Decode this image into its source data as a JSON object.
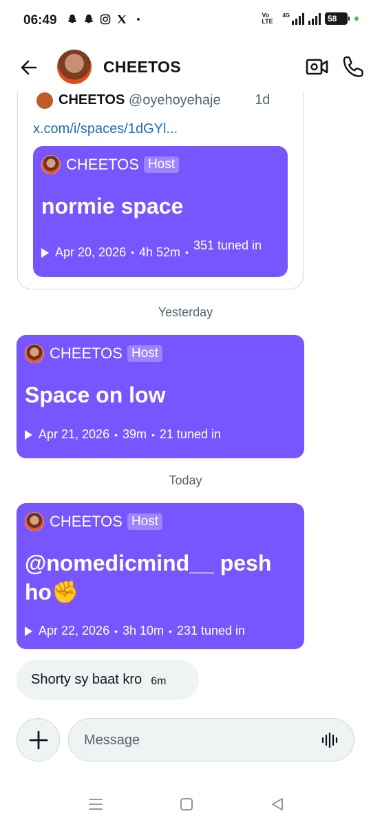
{
  "status_bar": {
    "time": "06:49",
    "left_icons": [
      "snapchat-icon",
      "snapchat-icon",
      "instagram-icon",
      "x-icon",
      "dot"
    ],
    "volte": "Vo LTE",
    "network": "4G",
    "battery": "58"
  },
  "header": {
    "title": "CHEETOS"
  },
  "shared_post": {
    "author": "CHEETOS",
    "handle": "@oyehoyehaje",
    "age": "1d",
    "link": "x.com/i/spaces/1dGYl..."
  },
  "spaces": [
    {
      "host": "CHEETOS",
      "badge": "Host",
      "title": "normie space",
      "date": "Apr 20, 2026",
      "duration": "4h 52m",
      "listeners": "351 tuned in"
    },
    {
      "host": "CHEETOS",
      "badge": "Host",
      "title": "Space on low",
      "date": "Apr 21, 2026",
      "duration": "39m",
      "listeners": "21 tuned in"
    },
    {
      "host": "CHEETOS",
      "badge": "Host",
      "title": "@nomedicmind__ pesh ho✊",
      "date": "Apr 22, 2026",
      "duration": "3h 10m",
      "listeners": "231 tuned in"
    }
  ],
  "dividers": {
    "yesterday": "Yesterday",
    "today": "Today"
  },
  "message": {
    "text": "Shorty sy baat kro",
    "time": "6m"
  },
  "composer": {
    "placeholder": "Message"
  },
  "colors": {
    "space_card": "#7856ff",
    "bubble": "#eff3f4",
    "link": "#1d6fb8"
  }
}
